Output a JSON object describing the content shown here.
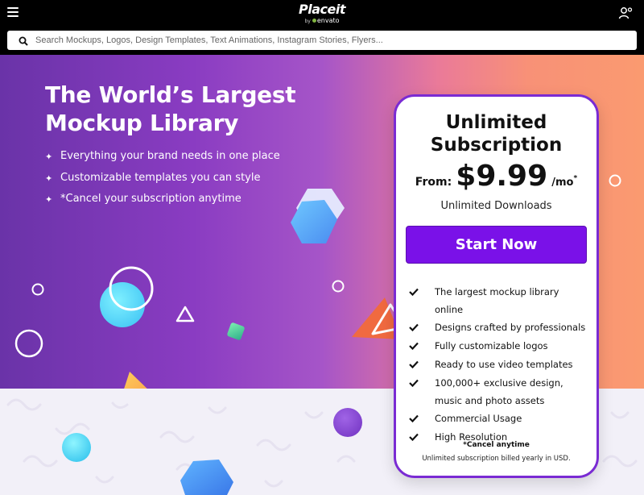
{
  "nav": {
    "logo_main": "Placeit",
    "logo_by": "by",
    "logo_sub": "envato",
    "menu_icon": "hamburger-menu-icon",
    "user_icon": "user-account-icon"
  },
  "search": {
    "placeholder": "Search Mockups, Logos, Design Templates, Text Animations, Instagram Stories, Flyers...",
    "icon": "search-icon"
  },
  "hero": {
    "title_line1": "The World’s Largest",
    "title_line2": "Mockup Library",
    "bullet_icon": "✦",
    "bullets": [
      "Everything your brand needs in one place",
      "Customizable templates you can style",
      "*Cancel your subscription anytime"
    ]
  },
  "card": {
    "title_line1": "Unlimited",
    "title_line2": "Subscription",
    "price_from": "From:",
    "price_amount": "$9.99",
    "price_per": "/mo",
    "price_star": "*",
    "subtitle": "Unlimited Downloads",
    "cta_label": "Start Now",
    "features": [
      "The largest mockup library online",
      "Designs crafted by professionals",
      "Fully customizable logos",
      "Ready to use video templates",
      "100,000+ exclusive design, music and photo assets",
      "Commercial Usage",
      "High Resolution"
    ],
    "note_bold": "*Cancel anytime",
    "note": "Unlimited subscription billed yearly in USD."
  },
  "colors": {
    "accent": "#7a11e8",
    "card_border": "#7a2bd3",
    "nav_bg": "#000000"
  }
}
